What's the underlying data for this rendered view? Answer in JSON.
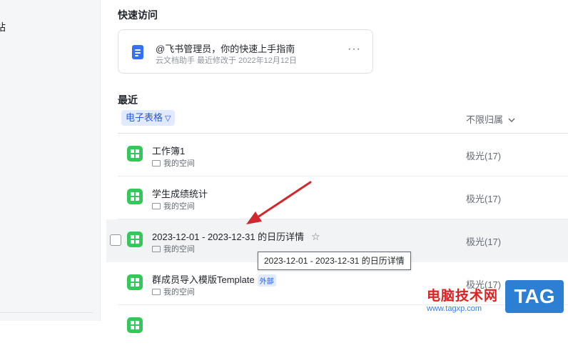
{
  "sidebar": {
    "partial_label": "站"
  },
  "quick_access": {
    "title": "快速访问",
    "card": {
      "title": "@飞书管理员，你的快速上手指南",
      "meta": "云文档助手 最近修改于 2022年12月12日",
      "more": "···"
    }
  },
  "recent": {
    "title": "最近",
    "filter_chip": "电子表格",
    "owner_filter": "不限归属",
    "files": [
      {
        "name": "工作簿1",
        "location": "我的空间",
        "owner": "极光(17)"
      },
      {
        "name": "学生成绩统计",
        "location": "我的空间",
        "owner": "极光(17)"
      },
      {
        "name": "2023-12-01 - 2023-12-31 的日历详情",
        "location": "我的空间",
        "owner": "极光(17)"
      },
      {
        "name": "群成员导入模版Template",
        "badge": "外部",
        "location": "我的空间",
        "owner": "极光(17)"
      }
    ]
  },
  "tooltip": "2023-12-01 - 2023-12-31 的日历详情",
  "watermark": {
    "site": "电脑技术网",
    "url": "www.tagxp.com",
    "tag": "TAG"
  },
  "colors": {
    "accent": "#3370ff",
    "sheet_green": "#34c759",
    "annotation_red": "#d0282e"
  },
  "icons": {
    "doc": "doc-icon",
    "sheet": "sheet-icon",
    "folder": "folder-icon",
    "star": "star-icon",
    "filter": "filter-icon",
    "chevron": "chevron-down-icon"
  }
}
